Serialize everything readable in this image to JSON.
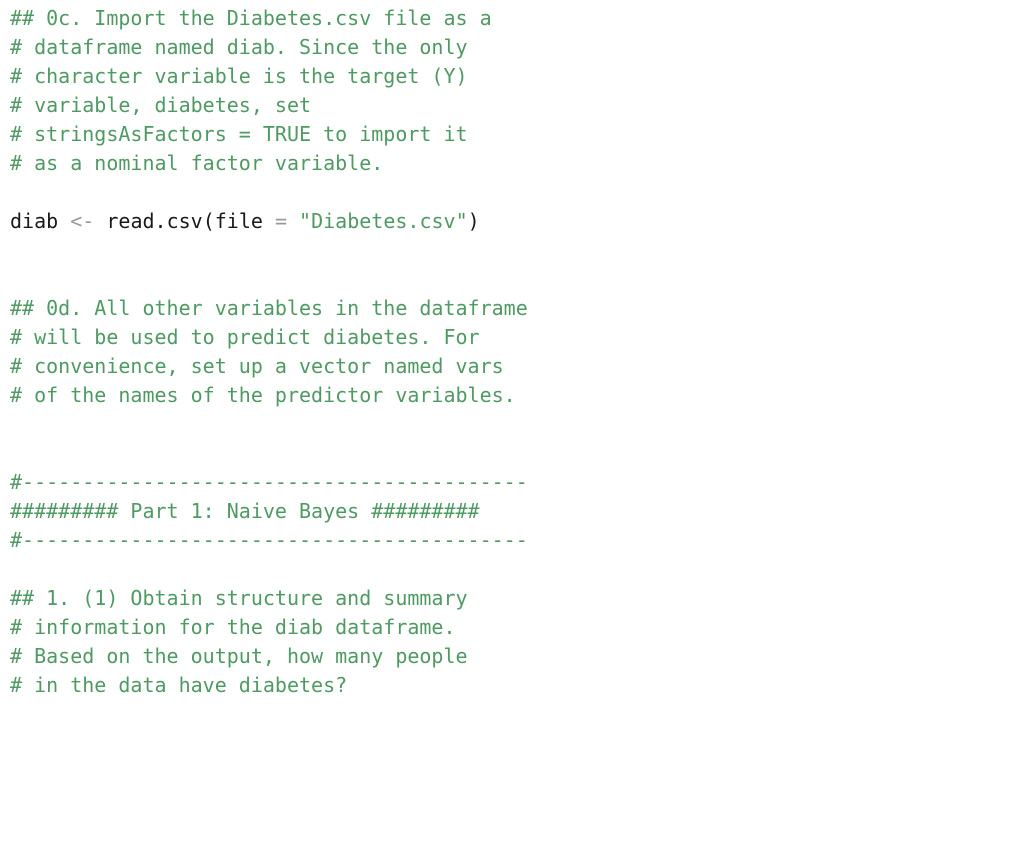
{
  "code": {
    "comment_0c_l1": "## 0c. Import the Diabetes.csv file as a",
    "comment_0c_l2": "# dataframe named diab. Since the only",
    "comment_0c_l3": "# character variable is the target (Y)",
    "comment_0c_l4": "# variable, diabetes, set",
    "comment_0c_l5": "# stringsAsFactors = TRUE to import it",
    "comment_0c_l6": "# as a nominal factor variable.",
    "assign_var": "diab",
    "assign_op": "<-",
    "func_name": "read.csv",
    "lparen": "(",
    "arg_name": "file",
    "arg_eq": " = ",
    "arg_value": "\"Diabetes.csv\"",
    "rparen": ")",
    "comment_0d_l1": "## 0d. All other variables in the dataframe",
    "comment_0d_l2": "# will be used to predict diabetes. For",
    "comment_0d_l3": "# convenience, set up a vector named vars",
    "comment_0d_l4": "# of the names of the predictor variables.",
    "rule_top": "#------------------------------------------",
    "part1_title": "######### Part 1: Naive Bayes #########",
    "rule_bot": "#------------------------------------------",
    "comment_1_l1": "## 1. (1) Obtain structure and summary",
    "comment_1_l2": "# information for the diab dataframe.",
    "comment_1_l3": "# Based on the output, how many people",
    "comment_1_l4": "# in the data have diabetes?"
  }
}
